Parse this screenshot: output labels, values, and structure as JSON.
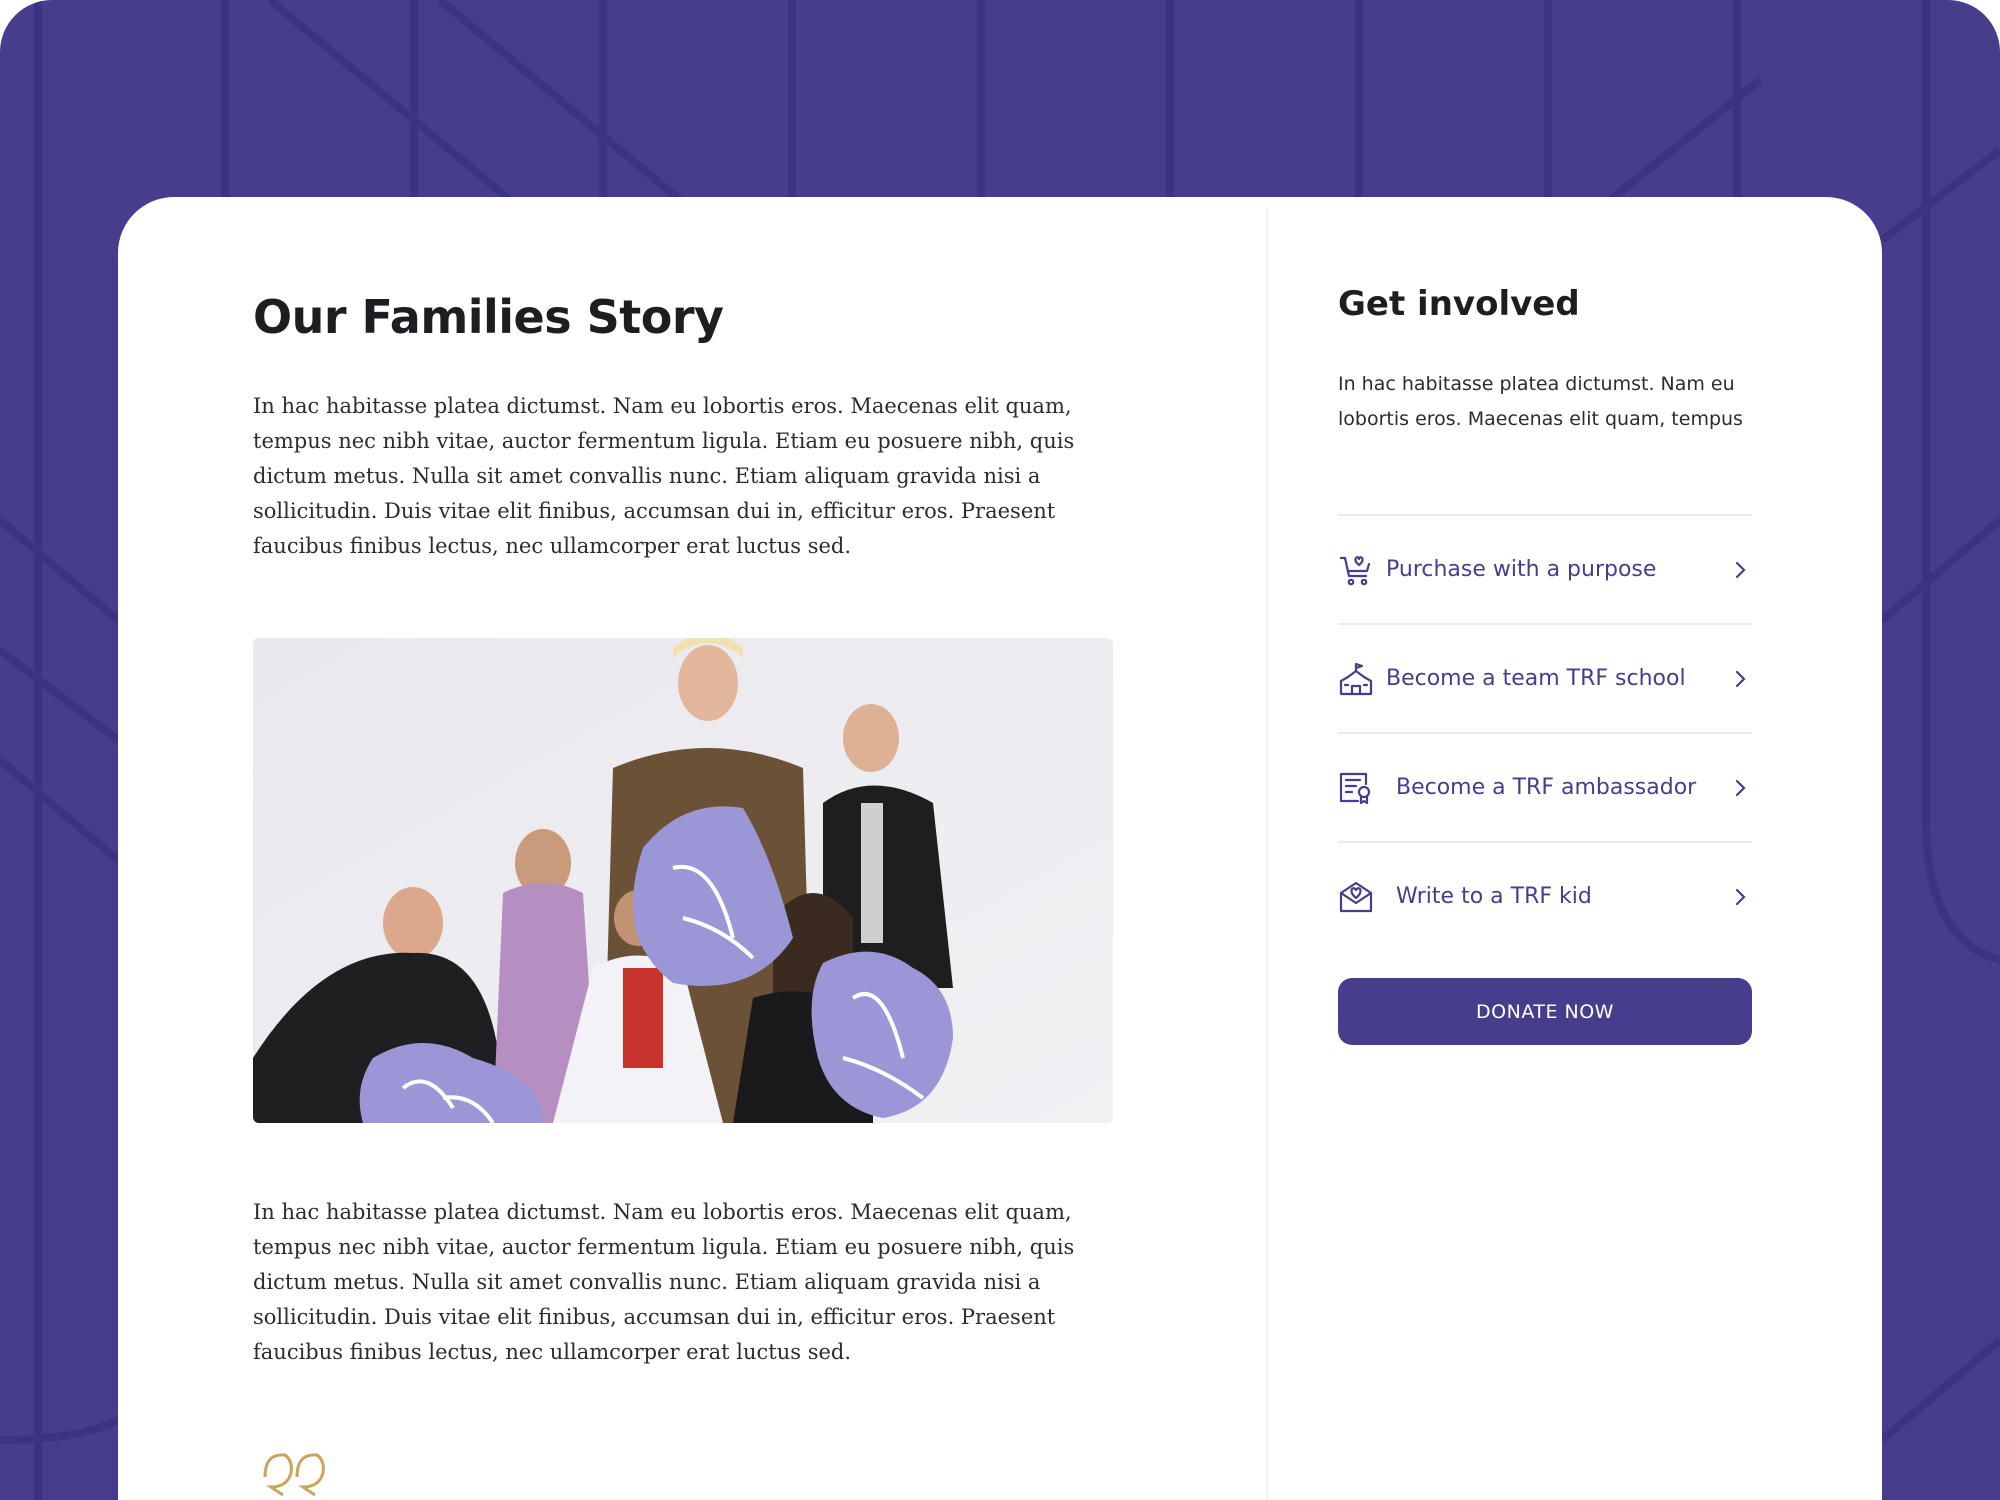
{
  "main": {
    "title": "Our Families Story",
    "paragraph_1": "In hac habitasse platea dictumst. Nam eu lobortis eros. Maecenas elit quam, tempus nec nibh vitae, auctor fermentum ligula. Etiam eu posuere nibh, quis dictum metus. Nulla sit amet convallis nunc. Etiam aliquam gravida nisi a sollicitudin. Duis vitae elit finibus, accumsan dui in, efficitur eros. Praesent faucibus finibus lectus, nec ullamcorper erat luctus sed.",
    "paragraph_2": "In hac habitasse platea dictumst. Nam eu lobortis eros. Maecenas elit quam, tempus nec nibh vitae, auctor fermentum ligula. Etiam eu posuere nibh, quis dictum metus. Nulla sit amet convallis nunc. Etiam aliquam gravida nisi a sollicitudin. Duis vitae elit finibus, accumsan dui in, efficitur eros. Praesent faucibus finibus lectus, nec ullamcorper erat luctus sed."
  },
  "aside": {
    "title": "Get involved",
    "text": "In hac habitasse platea dictumst. Nam eu lobortis eros. Maecenas elit quam, tempus",
    "links": [
      {
        "label": "Purchase with a purpose",
        "icon": "shopping-cart-heart-icon"
      },
      {
        "label": "Become a team TRF school",
        "icon": "school-building-icon"
      },
      {
        "label": "Become a TRF ambassador",
        "icon": "certificate-icon"
      },
      {
        "label": "Write to a TRF kid",
        "icon": "envelope-heart-icon"
      }
    ],
    "donate_label": "DONATE NOW"
  },
  "colors": {
    "brand_purple": "#463e8c",
    "accent_lavender": "#9b97d6",
    "quote_gold": "#c9a45a",
    "text_dark": "#1d1d22"
  }
}
